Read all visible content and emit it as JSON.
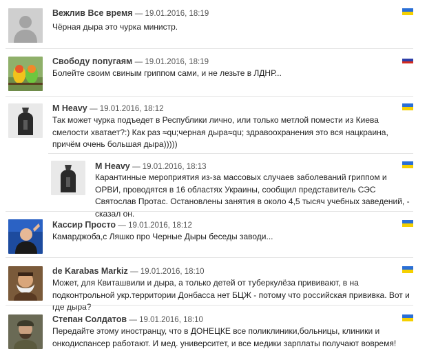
{
  "comments": [
    {
      "author": "Вежлив Все время",
      "sep": "— 19.01.2016, 18:19",
      "text": "Чёрная дыра это чурка министр.",
      "flag": "ua-flag",
      "avatar": "default-avatar"
    },
    {
      "author": "Свободу попугаям",
      "sep": "— 19.01.2016, 18:19",
      "text": "Болейте своим свиным гриппом сами, и не лезьте в ЛДНР...",
      "flag": "ru-flag",
      "avatar": "parrots-avatar"
    },
    {
      "author": "M Heavy",
      "sep": "— 19.01.2016, 18:12",
      "text": "Так может чурка подъедет в Республики лично, или только метлой помести из Киева смелости хватает?:) Как раз ≈qu;черная дыра≈qu; здравоохранения это вся нацкраина, причём очень большая дыра)))))",
      "flag": "ua-flag",
      "avatar": "spartan-avatar"
    },
    {
      "author": "M Heavy",
      "sep": "— 19.01.2016, 18:13",
      "text": "Карантинные мероприятия из-за массовых случаев заболеваний гриппом и ОРВИ, проводятся в 16 областях Украины, сообщил представитель СЭС Святослав Протас. Остановлены занятия в около 4,5 тысяч учебных заведений, - сказал он.",
      "flag": "ua-flag",
      "avatar": "spartan-avatar"
    },
    {
      "author": "Кассир Просто",
      "sep": "— 19.01.2016, 18:12",
      "text": "Камарджоба,с Ляшко про Черные Дыры беседы заводи...",
      "flag": "ua-flag",
      "avatar": "man-avatar"
    },
    {
      "author": "de Karabas Markiz",
      "sep": "— 19.01.2016, 18:10",
      "text": "Может, для Квиташвили и дыра, а только детей от туберкулёза прививают, в на подконтрольной укр.территории Донбасса нет БЦЖ - потому что российская прививка. Вот и где дыра?",
      "flag": "ua-flag",
      "avatar": "bearded-avatar"
    },
    {
      "author": "Степан Солдатов",
      "sep": "— 19.01.2016, 18:10",
      "text": "Передайте этому иностранцу, что в ДОНЕЦКЕ все поликлиники,больницы, клиники и онкодиспансер работают. И мед. университет, и все медики зарплаты получают вовремя!",
      "flag": "ua-flag",
      "avatar": "soldier-avatar"
    }
  ],
  "colors": {
    "ua_blue": "#2a6fd6",
    "ua_yellow": "#f5d000",
    "divider": "#e3e3e3"
  }
}
